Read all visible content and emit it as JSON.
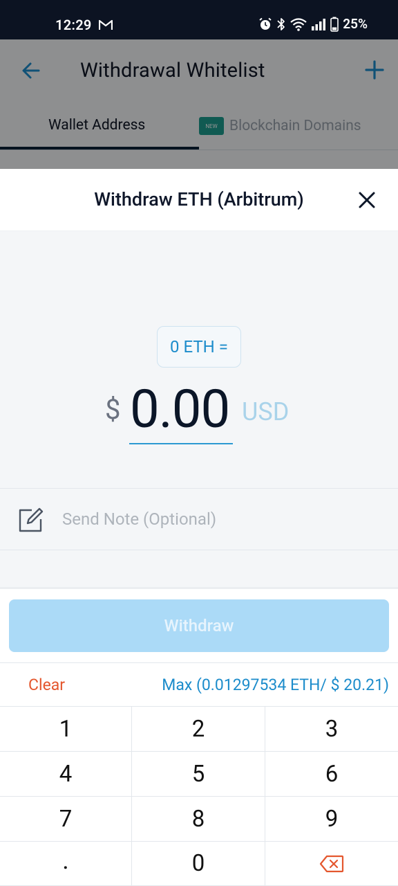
{
  "status_bar": {
    "time": "12:29",
    "battery": "25%",
    "icons": [
      "gmail-icon",
      "alarm-icon",
      "bluetooth-icon",
      "wifi-icon",
      "signal-icon",
      "battery-icon"
    ]
  },
  "background_page": {
    "title": "Withdrawal Whitelist",
    "tabs": [
      {
        "label": "Wallet Address",
        "active": true
      },
      {
        "label": "Blockchain Domains",
        "badge": "NEW",
        "active": false
      }
    ]
  },
  "sheet": {
    "title": "Withdraw ETH (Arbitrum)",
    "conversion_pill": "0 ETH =",
    "currency_symbol": "$",
    "amount": "0.00",
    "amount_currency": "USD",
    "note_placeholder": "Send Note (Optional)",
    "withdraw_label": "Withdraw",
    "clear_label": "Clear",
    "max_label": "Max (0.01297534 ETH/ $ 20.21)"
  },
  "keypad": {
    "keys": [
      "1",
      "2",
      "3",
      "4",
      "5",
      "6",
      "7",
      "8",
      "9",
      ".",
      "0"
    ],
    "backspace_icon": "backspace-icon"
  },
  "colors": {
    "accent": "#1c8ccb",
    "clear": "#e4572e",
    "withdraw_disabled": "#abdaf7",
    "status_bar": "#0c1322"
  }
}
